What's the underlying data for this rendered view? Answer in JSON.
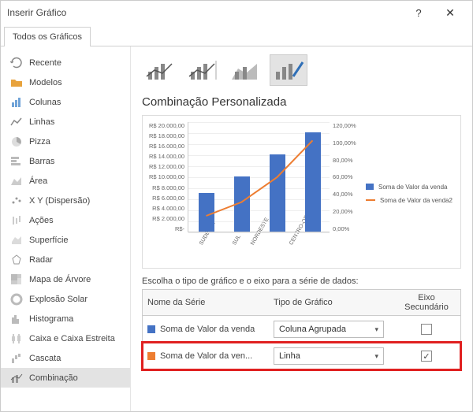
{
  "window": {
    "title": "Inserir Gráfico"
  },
  "tabs": {
    "all": "Todos os Gráficos"
  },
  "sidebar": {
    "items": [
      {
        "label": "Recente"
      },
      {
        "label": "Modelos"
      },
      {
        "label": "Colunas"
      },
      {
        "label": "Linhas"
      },
      {
        "label": "Pizza"
      },
      {
        "label": "Barras"
      },
      {
        "label": "Área"
      },
      {
        "label": "X Y (Dispersão)"
      },
      {
        "label": "Ações"
      },
      {
        "label": "Superfície"
      },
      {
        "label": "Radar"
      },
      {
        "label": "Mapa de Árvore"
      },
      {
        "label": "Explosão Solar"
      },
      {
        "label": "Histograma"
      },
      {
        "label": "Caixa e Caixa Estreita"
      },
      {
        "label": "Cascata"
      },
      {
        "label": "Combinação"
      }
    ]
  },
  "subtitle": "Combinação Personalizada",
  "instruction": "Escolha o tipo de gráfico e o eixo para a série de dados:",
  "series_header": {
    "name": "Nome da Série",
    "type": "Tipo de Gráfico",
    "sec": "Eixo Secundário"
  },
  "series": [
    {
      "color": "#4472C4",
      "name": "Soma de Valor da venda",
      "type": "Coluna Agrupada",
      "sec": false
    },
    {
      "color": "#ED7D31",
      "name": "Soma de Valor da ven...",
      "type": "Linha",
      "sec": true
    }
  ],
  "legend": {
    "s1": "Soma de Valor da venda",
    "s2": "Soma de Valor da venda2"
  },
  "chart_data": {
    "type": "combo",
    "categories": [
      "SUDESTE",
      "SUL",
      "NORDESTE",
      "CENTRO-OESTE"
    ],
    "series": [
      {
        "name": "Soma de Valor da venda",
        "type": "bar",
        "axis": "primary",
        "values": [
          7000,
          10000,
          14000,
          18000
        ]
      },
      {
        "name": "Soma de Valor da venda2",
        "type": "line",
        "axis": "secondary",
        "values": [
          18,
          33,
          60,
          100
        ]
      }
    ],
    "y1": {
      "min": 0,
      "max": 20000,
      "step": 2000,
      "format": "R$ #.##0,00",
      "ticks": [
        "R$ 20.000,00",
        "R$ 18.000,00",
        "R$ 16.000,00",
        "R$ 14.000,00",
        "R$ 12.000,00",
        "R$ 10.000,00",
        "R$ 8.000,00",
        "R$ 6.000,00",
        "R$ 4.000,00",
        "R$ 2.000,00",
        "R$-"
      ]
    },
    "y2": {
      "min": 0,
      "max": 120,
      "step": 20,
      "format": "0,00%",
      "ticks": [
        "120,00%",
        "100,00%",
        "80,00%",
        "60,00%",
        "40,00%",
        "20,00%",
        "0,00%"
      ]
    }
  }
}
